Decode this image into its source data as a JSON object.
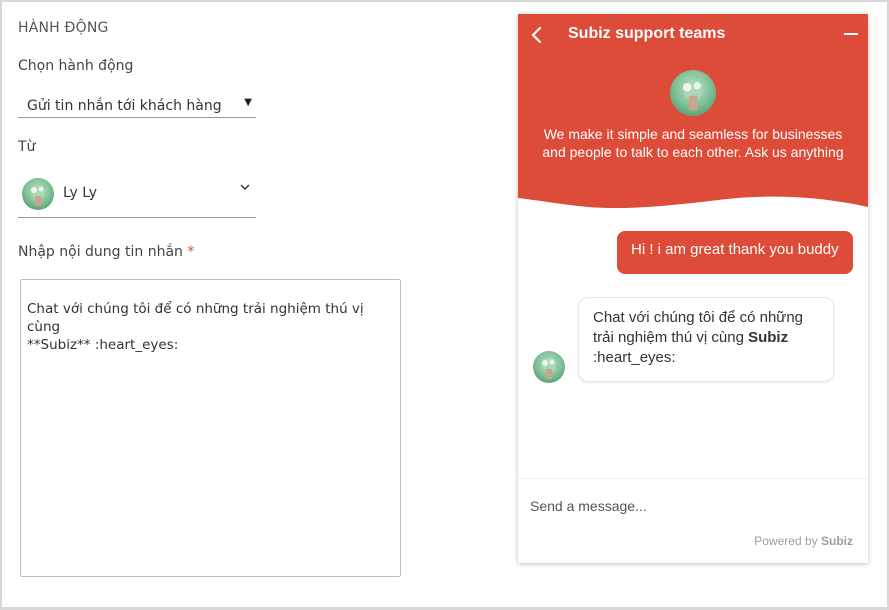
{
  "action_section": {
    "title": "HÀNH ĐỘNG",
    "choose_action_label": "Chọn hành động",
    "choose_action_value": "Gửi tin nhắn tới khách hàng",
    "from_label": "Từ",
    "from_value": "Ly Ly",
    "message_label": "Nhập nội dung tin nhắn",
    "required_mark": "*",
    "message_value": "Chat với chúng tôi để có những trải nghiệm thú vị cùng\n**Subiz** :heart_eyes:"
  },
  "chat_widget": {
    "title": "Subiz support teams",
    "tagline": "We make it simple and seamless for businesses and people to talk to each other. Ask us anything",
    "brand_color": "#dd4b39",
    "messages": {
      "outgoing": "Hi ! i am great thank you buddy",
      "incoming_text": "Chat với chúng tôi để có những trải nghiệm thú vị cùng",
      "incoming_bold": "Subiz",
      "incoming_suffix": ":heart_eyes:"
    },
    "composer_placeholder": "Send a message...",
    "powered_prefix": "Powered by",
    "powered_brand": "Subiz"
  }
}
